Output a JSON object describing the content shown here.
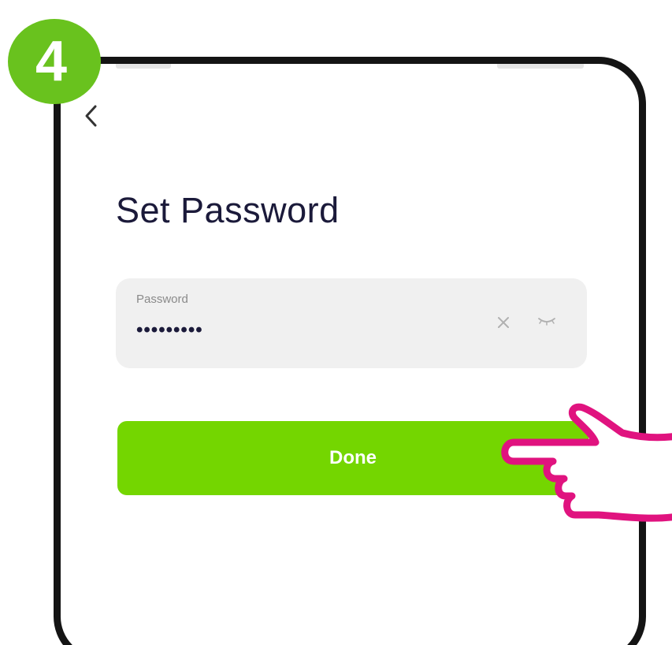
{
  "step": {
    "number": "4",
    "badge_color": "#69c21e"
  },
  "screen": {
    "back_icon": "chevron-left-icon",
    "title": "Set Password",
    "password_field": {
      "label": "Password",
      "value": "•••••••••",
      "clear_icon": "close-icon",
      "visibility_icon": "eye-closed-icon"
    },
    "done_button": {
      "label": "Done",
      "color": "#74d600"
    }
  },
  "annotation": {
    "pointer_icon": "hand-pointer-icon",
    "pointer_color": "#e0137f"
  },
  "colors": {
    "title_text": "#1b1a3a",
    "field_background": "#f0f0f0",
    "frame": "#141414"
  }
}
